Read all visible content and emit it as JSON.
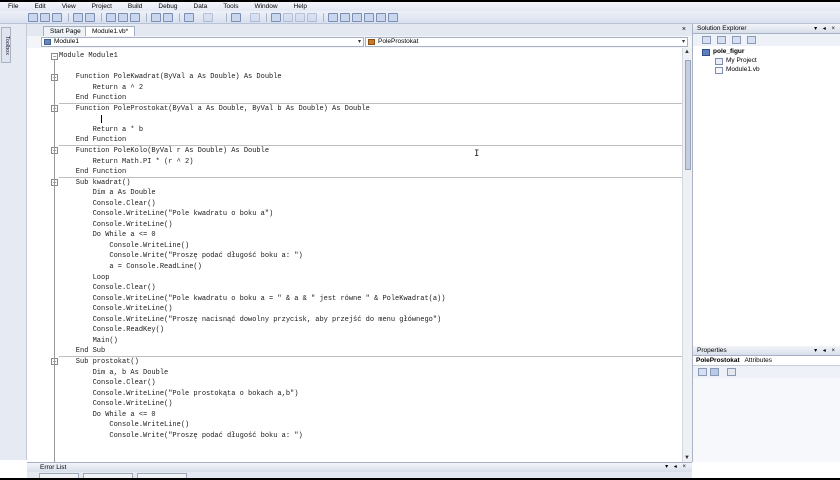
{
  "menu": [
    "File",
    "Edit",
    "View",
    "Project",
    "Build",
    "Debug",
    "Data",
    "Tools",
    "Window",
    "Help"
  ],
  "toolbox_label": "Toolbox",
  "tabs": [
    {
      "label": "Start Page",
      "active": false
    },
    {
      "label": "Module1.vb*",
      "active": true
    }
  ],
  "tab_close": "×",
  "dropdowns": {
    "left": "Module1",
    "right": "PoleProstokat",
    "arrow": "▾"
  },
  "code_lines": [
    "Module Module1",
    "",
    "    Function PoleKwadrat(ByVal a As Double) As Double",
    "        Return a ^ 2",
    "    End Function",
    "    Function PoleProstokat(ByVal a As Double, ByVal b As Double) As Double",
    "",
    "        Return a * b",
    "    End Function",
    "    Function PoleKolo(ByVal r As Double) As Double",
    "        Return Math.PI * (r ^ 2)",
    "    End Function",
    "    Sub kwadrat()",
    "        Dim a As Double",
    "        Console.Clear()",
    "        Console.WriteLine(\"Pole kwadratu o boku a\")",
    "        Console.WriteLine()",
    "        Do While a <= 0",
    "            Console.WriteLine()",
    "            Console.Write(\"Proszę podać długość boku a: \")",
    "            a = Console.ReadLine()",
    "        Loop",
    "        Console.Clear()",
    "        Console.WriteLine(\"Pole kwadratu o boku a = \" & a & \" jest równe \" & PoleKwadrat(a))",
    "        Console.WriteLine()",
    "        Console.WriteLine(\"Proszę nacisnąć dowolny przycisk, aby przejść do menu głównego\")",
    "        Console.ReadKey()",
    "        Main()",
    "    End Sub",
    "    Sub prostokat()",
    "        Dim a, b As Double",
    "        Console.Clear()",
    "        Console.WriteLine(\"Pole prostokąta o bokach a,b\")",
    "        Console.WriteLine()",
    "        Do While a <= 0",
    "            Console.WriteLine()",
    "            Console.Write(\"Proszę podać długość boku a: \")"
  ],
  "solution_explorer": {
    "title": "Solution Explorer",
    "controls": "▾ ◂ ×",
    "items": [
      {
        "label": "pole_figur",
        "bold": true
      },
      {
        "label": "My Project",
        "bold": false
      },
      {
        "label": "Module1.vb",
        "bold": false
      }
    ]
  },
  "properties": {
    "title": "Properties",
    "controls": "▾ ◂ ×",
    "object": "PoleProstokat",
    "object_type": "Attributes"
  },
  "error_list": {
    "title": "Error List",
    "controls": "▾ ◂ ×"
  }
}
